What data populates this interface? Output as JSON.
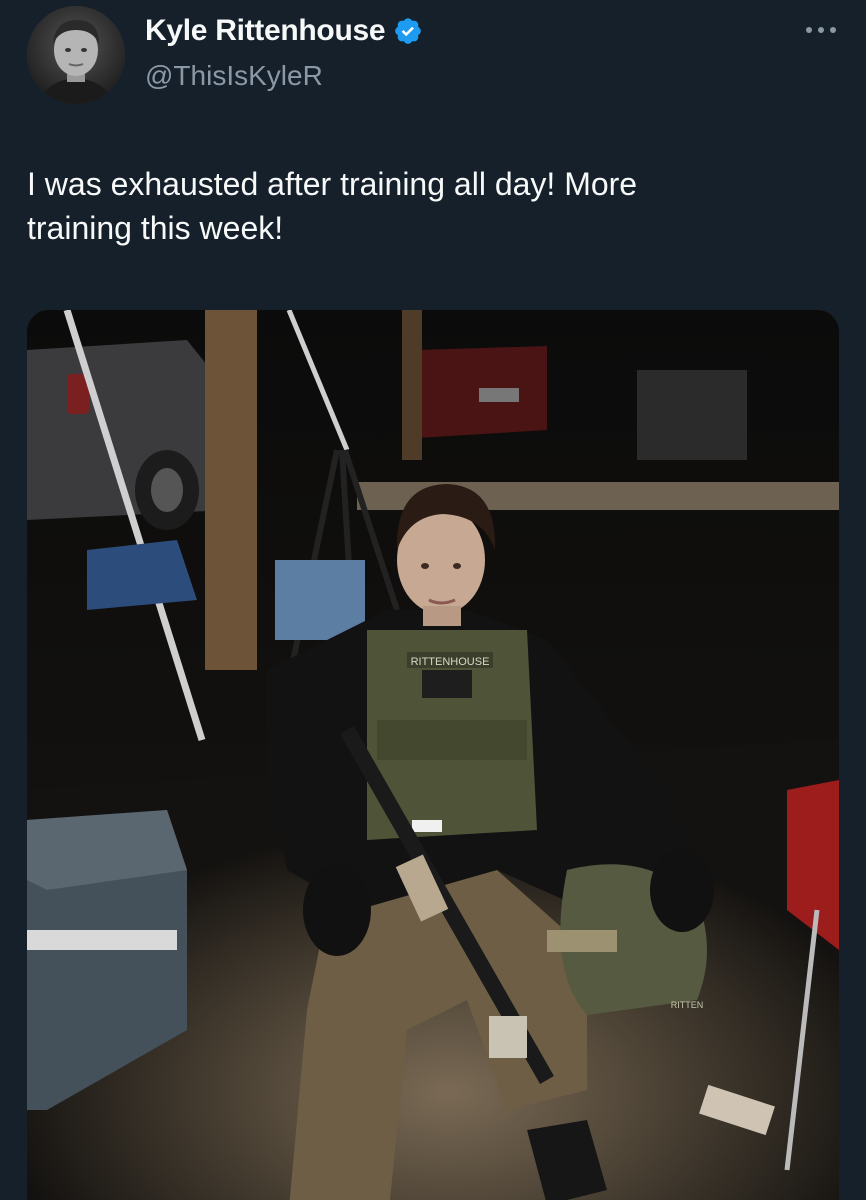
{
  "author": {
    "display_name": "Kyle Rittenhouse",
    "handle": "@ThisIsKyleR",
    "verified": true,
    "verified_color": "#1d9bf0"
  },
  "tweet": {
    "text": "I was exhausted after training all day! More\ntraining this week!"
  },
  "media": {
    "vest_patch": "RITTENHOUSE",
    "helmet_label": "RITTEN"
  },
  "icons": {
    "verified": "verified-badge-icon",
    "more": "more-options-icon"
  },
  "colors": {
    "background": "#15202b",
    "primary_text": "#f7f9f9",
    "secondary_text": "#8b98a5"
  }
}
